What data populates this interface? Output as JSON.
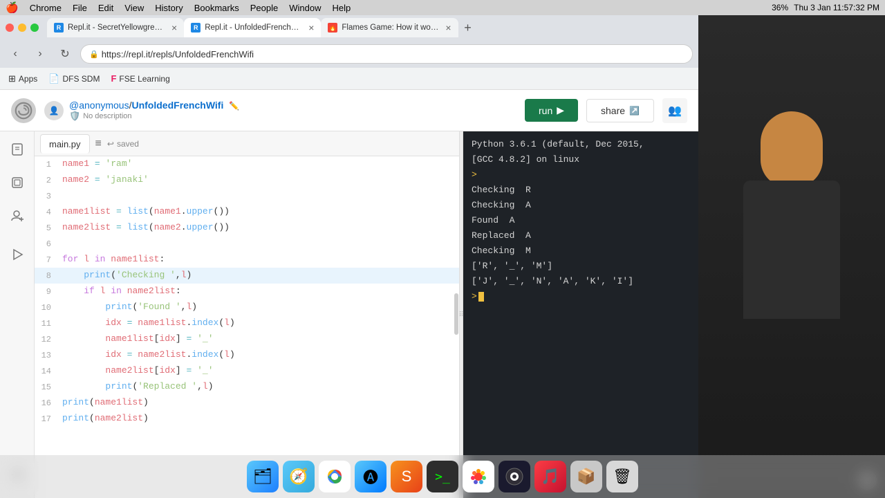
{
  "menubar": {
    "apple": "🍎",
    "items": [
      "Chrome",
      "File",
      "Edit",
      "View",
      "History",
      "Bookmarks",
      "People",
      "Window",
      "Help"
    ],
    "right": {
      "battery": "36%",
      "time": "Thu 3 Jan  11:57:32 PM"
    }
  },
  "browser": {
    "tabs": [
      {
        "id": "tab1",
        "title": "Repl.it - SecretYellowgreenVer...",
        "active": false,
        "favicon_color": "#1e88e5"
      },
      {
        "id": "tab2",
        "title": "Repl.it - UnfoldedFrenchWifi",
        "active": true,
        "favicon_color": "#1e88e5"
      },
      {
        "id": "tab3",
        "title": "Flames Game: How it works?",
        "active": false,
        "favicon_color": "#f44336"
      }
    ],
    "address": "https://repl.it/repls/UnfoldedFrenchWifi",
    "bookmarks": [
      {
        "label": "Apps",
        "icon": "⊞"
      },
      {
        "label": "DFS SDM",
        "icon": "📄"
      },
      {
        "label": "FSE Learning",
        "icon": "🅕"
      }
    ]
  },
  "replit": {
    "user": "@anonymous",
    "repl_name": "UnfoldedFrenchWifi",
    "description": "No description",
    "run_label": "run",
    "share_label": "share",
    "file_tab": "main.py",
    "saved_label": "saved",
    "code_lines": [
      {
        "num": 1,
        "content": "name1 = 'ram'"
      },
      {
        "num": 2,
        "content": "name2 = 'janaki'"
      },
      {
        "num": 3,
        "content": ""
      },
      {
        "num": 4,
        "content": "name1list = list(name1.upper())"
      },
      {
        "num": 5,
        "content": "name2list = list(name2.upper())"
      },
      {
        "num": 6,
        "content": ""
      },
      {
        "num": 7,
        "content": "for l in name1list:"
      },
      {
        "num": 8,
        "content": "    print('Checking ',l)",
        "highlighted": true
      },
      {
        "num": 9,
        "content": "    if l in name2list:"
      },
      {
        "num": 10,
        "content": "        print('Found ',l)"
      },
      {
        "num": 11,
        "content": "        idx = name1list.index(l)"
      },
      {
        "num": 12,
        "content": "        name1list[idx] = '_'"
      },
      {
        "num": 13,
        "content": "        idx = name2list.index(l)"
      },
      {
        "num": 14,
        "content": "        name2list[idx] = '_'"
      },
      {
        "num": 15,
        "content": "        print('Replaced ',l)"
      },
      {
        "num": 16,
        "content": "print(name1list)"
      },
      {
        "num": 17,
        "content": "print(name2list)"
      }
    ],
    "console": {
      "header": "Python 3.6.1 (default, Dec 2015,",
      "header2": "[GCC 4.8.2] on linux",
      "lines": [
        {
          "type": "prompt",
          "text": ">"
        },
        {
          "type": "output",
          "text": "Checking  R"
        },
        {
          "type": "output",
          "text": "Checking  A"
        },
        {
          "type": "output",
          "text": "Found  A"
        },
        {
          "type": "output",
          "text": "Replaced  A"
        },
        {
          "type": "output",
          "text": "Checking  M"
        },
        {
          "type": "output",
          "text": "['R', '_', 'M']"
        },
        {
          "type": "output",
          "text": "['J', '_', 'N', 'A', 'K', 'I']"
        },
        {
          "type": "prompt_active",
          "text": "> "
        }
      ]
    }
  },
  "dock": {
    "items": [
      {
        "name": "finder",
        "emoji": "🗂",
        "color": "#1a73e8"
      },
      {
        "name": "safari",
        "emoji": "🧭",
        "color": "#1a73e8"
      },
      {
        "name": "chrome",
        "emoji": "⬤",
        "color": "#4285f4"
      },
      {
        "name": "appstore",
        "emoji": "🅐",
        "color": "#1a73e8"
      },
      {
        "name": "sublime",
        "emoji": "⬤",
        "color": "#f4821f"
      },
      {
        "name": "terminal",
        "emoji": "⬛",
        "color": "#333"
      },
      {
        "name": "photos",
        "emoji": "🌸",
        "color": "#f00"
      },
      {
        "name": "obs",
        "emoji": "⬤",
        "color": "#1a1a2e"
      },
      {
        "name": "itunes",
        "emoji": "🎵",
        "color": "#fc3c44"
      },
      {
        "name": "imagemagick",
        "emoji": "📦",
        "color": "#888"
      },
      {
        "name": "trash",
        "emoji": "🗑",
        "color": "#888"
      }
    ]
  }
}
